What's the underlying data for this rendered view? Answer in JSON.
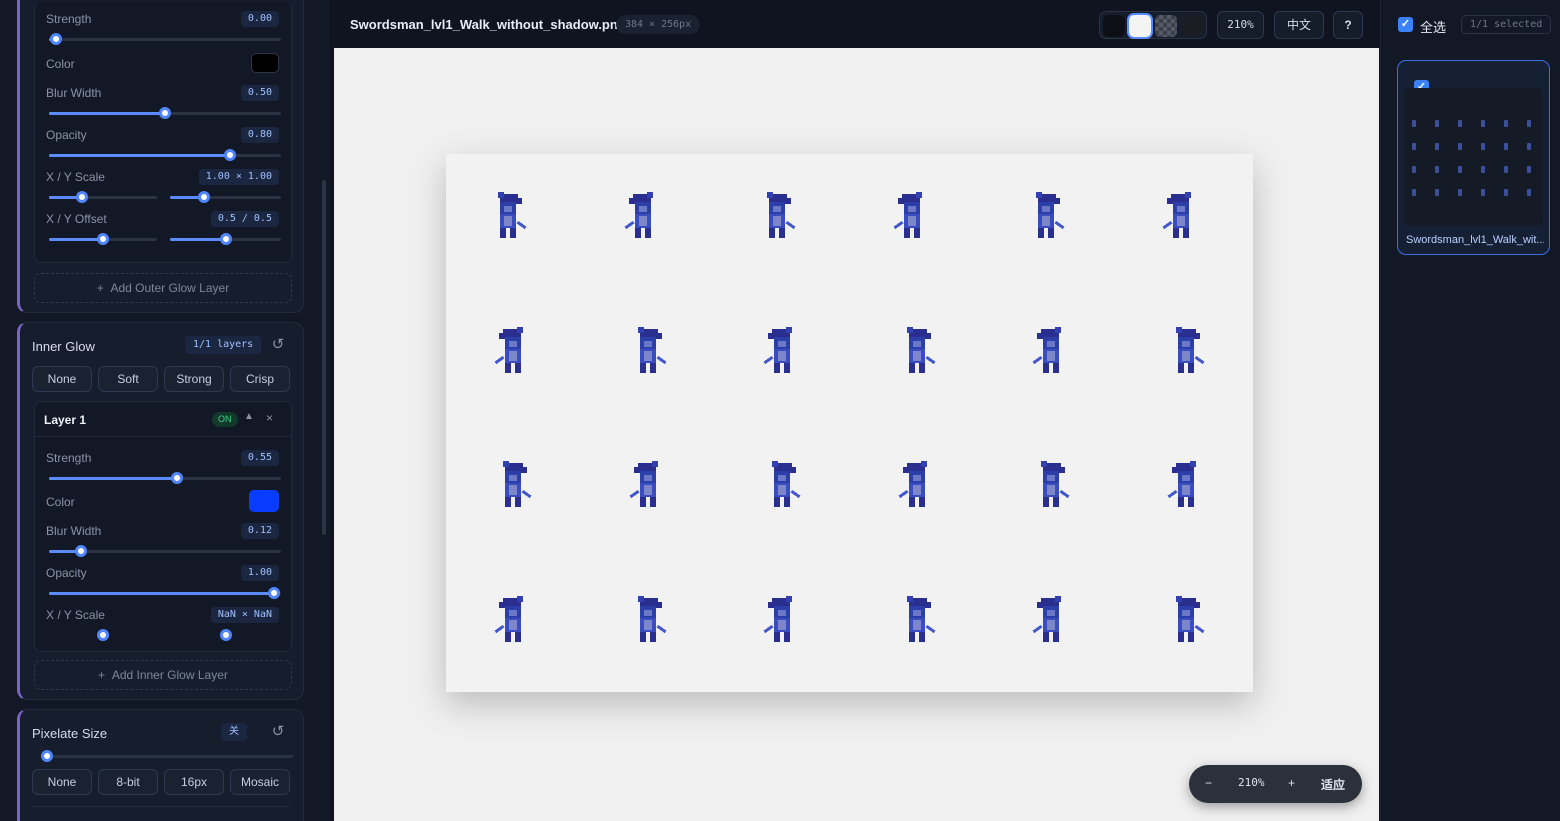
{
  "outer_glow": {
    "strength_label": "Strength",
    "strength_value": "0.00",
    "strength_frac": 0.03,
    "color_label": "Color",
    "color": "#000000",
    "blur_label": "Blur Width",
    "blur_value": "0.50",
    "blur_frac": 0.5,
    "opacity_label": "Opacity",
    "opacity_value": "0.80",
    "opacity_frac": 0.78,
    "scale_label": "X / Y Scale",
    "scale_value": "1.00 × 1.00",
    "offset_label": "X / Y Offset",
    "offset_value": "0.5 / 0.5",
    "add_label": "Add Outer Glow Layer"
  },
  "inner_glow": {
    "title": "Inner Glow",
    "layers_badge": "1/1 layers",
    "presets": [
      "None",
      "Soft",
      "Strong",
      "Crisp"
    ],
    "layer_title": "Layer 1",
    "layer_on": "ON",
    "strength_label": "Strength",
    "strength_value": "0.55",
    "strength_frac": 0.55,
    "color_label": "Color",
    "color": "#0a3cff",
    "blur_label": "Blur Width",
    "blur_value": "0.12",
    "blur_frac": 0.14,
    "opacity_label": "Opacity",
    "opacity_value": "1.00",
    "opacity_frac": 0.97,
    "scale_label": "X / Y Scale",
    "scale_value": "NaN × NaN",
    "add_label": "Add Inner Glow Layer"
  },
  "pixelate": {
    "title": "Pixelate Size",
    "state_badge": "关",
    "size_frac": 0.0,
    "presets": [
      "None",
      "8-bit",
      "16px",
      "Mosaic"
    ]
  },
  "header": {
    "file_name": "Swordsman_lvl1_Walk_without_shadow.png",
    "dimensions": "384 × 256px",
    "zoom": "210%",
    "lang": "中文",
    "help": "?"
  },
  "zoom_controls": {
    "minus": "−",
    "value": "210%",
    "plus": "+",
    "fit": "适应"
  },
  "right_panel": {
    "select_all": "全选",
    "selected_count": "1/1 selected",
    "thumb_name": "Swordsman_lvl1_Walk_wit..."
  },
  "colors": {
    "accent": "#5b8cff",
    "section_border": "#7b63c8",
    "sprite_blue": "#2c3ea8"
  },
  "sprite_grid": {
    "rows": 4,
    "cols": 6
  }
}
